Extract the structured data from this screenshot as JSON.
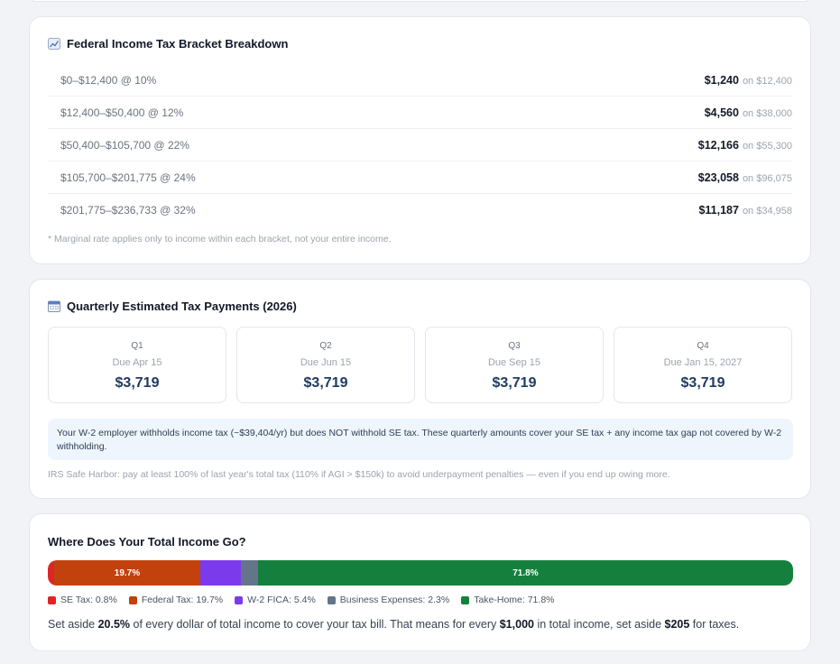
{
  "brackets_card": {
    "title": "Federal Income Tax Bracket Breakdown",
    "icon": "chart-icon",
    "rows": [
      {
        "range": "$0–$12,400 @ 10%",
        "amount": "$1,240",
        "on": "on $12,400"
      },
      {
        "range": "$12,400–$50,400 @ 12%",
        "amount": "$4,560",
        "on": "on $38,000"
      },
      {
        "range": "$50,400–$105,700 @ 22%",
        "amount": "$12,166",
        "on": "on $55,300"
      },
      {
        "range": "$105,700–$201,775 @ 24%",
        "amount": "$23,058",
        "on": "on $96,075"
      },
      {
        "range": "$201,775–$236,733 @ 32%",
        "amount": "$11,187",
        "on": "on $34,958"
      }
    ],
    "footnote": "* Marginal rate applies only to income within each bracket, not your entire income."
  },
  "quarterly_card": {
    "title": "Quarterly Estimated Tax Payments (2026)",
    "icon": "calendar-icon",
    "quarters": [
      {
        "label": "Q1",
        "due": "Due Apr 15",
        "amount": "$3,719"
      },
      {
        "label": "Q2",
        "due": "Due Jun 15",
        "amount": "$3,719"
      },
      {
        "label": "Q3",
        "due": "Due Sep 15",
        "amount": "$3,719"
      },
      {
        "label": "Q4",
        "due": "Due Jan 15, 2027",
        "amount": "$3,719"
      }
    ],
    "info": "Your W-2 employer withholds income tax (~$39,404/yr) but does NOT withhold SE tax. These quarterly amounts cover your SE tax + any income tax gap not covered by W-2 withholding.",
    "safe_harbor": "IRS Safe Harbor: pay at least 100% of last year's total tax (110% if AGI > $150k) to avoid underpayment penalties — even if you end up owing more."
  },
  "income_card": {
    "title": "Where Does Your Total Income Go?",
    "segments": [
      {
        "name": "SE Tax",
        "percent": 0.8,
        "label": "",
        "color": "#dc2626"
      },
      {
        "name": "Federal Tax",
        "percent": 19.7,
        "label": "19.7%",
        "color": "#c2410c"
      },
      {
        "name": "W-2 FICA",
        "percent": 5.4,
        "label": "",
        "color": "#7c3aed"
      },
      {
        "name": "Business Expenses",
        "percent": 2.3,
        "label": "",
        "color": "#64748b"
      },
      {
        "name": "Take-Home",
        "percent": 71.8,
        "label": "71.8%",
        "color": "#15803d"
      }
    ],
    "legend": [
      {
        "text": "SE Tax: 0.8%",
        "color": "#dc2626"
      },
      {
        "text": "Federal Tax: 19.7%",
        "color": "#c2410c"
      },
      {
        "text": "W-2 FICA: 5.4%",
        "color": "#7c3aed"
      },
      {
        "text": "Business Expenses: 2.3%",
        "color": "#64748b"
      },
      {
        "text": "Take-Home: 71.8%",
        "color": "#15803d"
      }
    ],
    "summary": {
      "p1": "Set aside ",
      "pct": "20.5%",
      "p2": " of every dollar of total income to cover your tax bill. That means for every ",
      "base": "$1,000",
      "p3": " in total income, set aside ",
      "aside": "$205",
      "p4": " for taxes."
    }
  }
}
